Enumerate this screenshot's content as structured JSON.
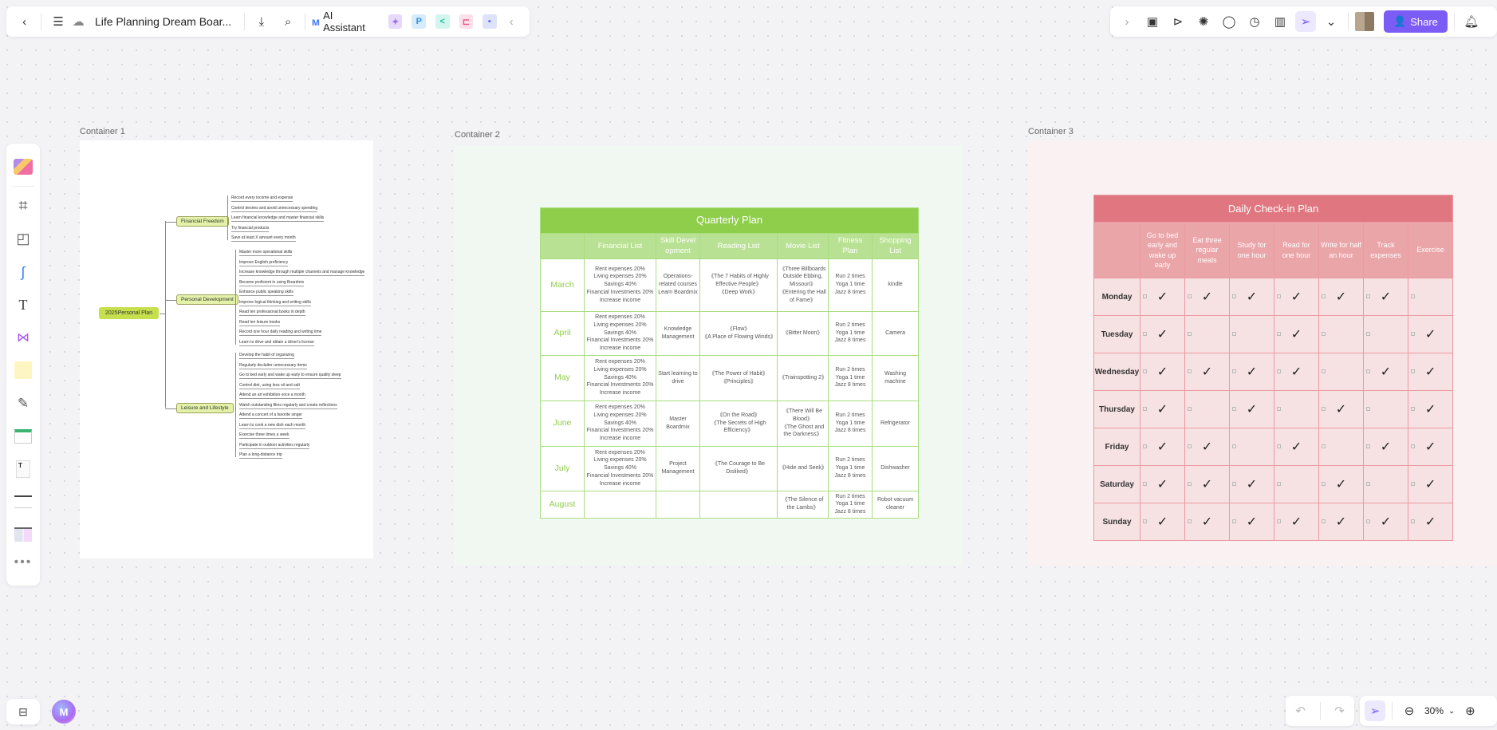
{
  "header": {
    "title": "Life Planning Dream Boar...",
    "ai_label": "AI Assistant",
    "share_label": "Share",
    "icons_left": [
      "back-icon",
      "menu-icon",
      "cloud-saved-icon",
      "download-icon",
      "search-icon"
    ],
    "ai_tools": [
      "image-gen-icon",
      "presentation-icon",
      "mindmap-icon",
      "flowchart-icon",
      "chat-icon"
    ],
    "icons_right": [
      "template-icon",
      "present-icon",
      "celebrate-icon",
      "comment-icon",
      "timer-icon",
      "vote-icon",
      "laser-pointer-icon",
      "more-icon"
    ]
  },
  "left_toolbar": [
    "templates",
    "frame",
    "shape",
    "connector",
    "text",
    "mindmap",
    "sticky-note",
    "pen",
    "table",
    "document",
    "list",
    "kanban",
    "more"
  ],
  "containers": [
    {
      "label": "Container 1"
    },
    {
      "label": "Container 2"
    },
    {
      "label": "Container 3"
    }
  ],
  "mindmap": {
    "root": "2025Personal Plan",
    "branches": [
      {
        "label": "Financial Freedom",
        "items": [
          "Record every income and expense",
          "Control desires and avoid unnecessary spending",
          "Learn financial knowledge and master financial skills",
          "Try financial products",
          "Save at least X amount every month"
        ]
      },
      {
        "label": "Personal Development",
        "items": [
          "Master more operational skills",
          "Improve English proficiency",
          "Increase knowledge through multiple channels and manage knowledge",
          "Become proficient in using Boardmix",
          "Enhance public speaking skills",
          "Improve logical thinking and writing skills",
          "Read ten professional books in depth",
          "Read ten leisure books",
          "Record one hour daily reading and writing time",
          "Learn to drive and obtain a driver's license"
        ]
      },
      {
        "label": "Leisure and Lifestyle",
        "items": [
          "Develop the habit of organizing",
          "Regularly declutter unnecessary items",
          "Go to bed early and wake up early to ensure quality sleep",
          "Control diet, using less oil and salt",
          "Attend an art exhibition once a month",
          "Watch outstanding films regularly and create reflections",
          "Attend a concert of a favorite singer",
          "Learn to cook a new dish each month",
          "Exercise three times a week",
          "Participate in outdoor activities regularly",
          "Plan a long-distance trip"
        ]
      }
    ]
  },
  "quarterly": {
    "title": "Quarterly Plan",
    "headers": [
      "",
      "Financial List",
      "Skill Devel opment",
      "Reading List",
      "Movie List",
      "Fitness Plan",
      "Shopping List"
    ],
    "rows": [
      [
        "March",
        "Rent expenses 20%\nLiving expenses 20%\nSavings 40%\nFinancial Investments 20%\nIncrease income",
        "Operations-related courses\nLearn Boardmix",
        "《The 7 Habits of Highly Effective People》\n《Deep Work》",
        "《Three Billboards Outside Ebbing, Missouri》\n《Entering the Hall of Fame》",
        "Run 2 times\nYoga 1 time\nJazz 8 times",
        "kindle"
      ],
      [
        "April",
        "Rent expenses 20%\nLiving expenses 20%\nSavings 40%\nFinancial Investments 20%\nIncrease income",
        "Knowledge Management",
        "《Flow》\n《A Place of Flowing Winds》",
        "《Bitter Moon》",
        "Run 2 times\nYoga 1 time\nJazz 8 times",
        "Camera"
      ],
      [
        "May",
        "Rent expenses 20%\nLiving expenses 20%\nSavings 40%\nFinancial Investments 20%\nIncrease income",
        "Start learning to drive",
        "《The Power of Habit》\n《Principles》",
        "《Trainspotting 2》",
        "Run 2 times\nYoga 1 time\nJazz 8 times",
        "Washing machine"
      ],
      [
        "June",
        "Rent expenses 20%\nLiving expenses 20%\nSavings 40%\nFinancial Investments 20%\nIncrease income",
        "Master Boardmix",
        "《On the Road》\n《The Secrets of High Efficiency》",
        "《There Will Be Blood》\n《The Ghost and the Darkness》",
        "Run 2 times\nYoga 1 time\nJazz 8 times",
        "Refrigerator"
      ],
      [
        "July",
        "Rent expenses 20%\nLiving expenses 20%\nSavings 40%\nFinancial Investments 20%\nIncrease income",
        "Project Management",
        "《The Courage to Be Disliked》",
        "《Hide and Seek》",
        "Run 2 times\nYoga 1 time\nJazz 8 times",
        "Dishwasher"
      ],
      [
        "August",
        "",
        "",
        "",
        "《The Silence of the Lambs》",
        "Run 2 times\nYoga 1 time\nJazz 8 times",
        "Robot vacuum cleaner"
      ]
    ]
  },
  "daily": {
    "title": "Daily Check-in Plan",
    "headers": [
      "",
      "Go to bed early and wake up early",
      "Eat three regular meals",
      "Study for one hour",
      "Read for one hour",
      "Write for half an hour",
      "Track expenses",
      "Exercise"
    ],
    "check_glyph": "✓",
    "rows": [
      {
        "day": "Monday",
        "checks": [
          true,
          true,
          true,
          true,
          true,
          true,
          false
        ]
      },
      {
        "day": "Tuesday",
        "checks": [
          true,
          false,
          false,
          true,
          false,
          false,
          true
        ]
      },
      {
        "day": "Wednesday",
        "checks": [
          true,
          true,
          true,
          true,
          false,
          true,
          true
        ]
      },
      {
        "day": "Thursday",
        "checks": [
          true,
          false,
          true,
          false,
          true,
          false,
          true
        ]
      },
      {
        "day": "Friday",
        "checks": [
          true,
          true,
          false,
          true,
          false,
          true,
          true
        ]
      },
      {
        "day": "Saturday",
        "checks": [
          true,
          true,
          true,
          false,
          true,
          false,
          true
        ]
      },
      {
        "day": "Sunday",
        "checks": [
          true,
          true,
          true,
          true,
          true,
          true,
          true
        ]
      }
    ]
  },
  "zoom": {
    "level": "30%"
  },
  "colors": {
    "accent": "#7b5cf5",
    "quarterly_green": "#8fce4b",
    "daily_red": "#e07680"
  }
}
